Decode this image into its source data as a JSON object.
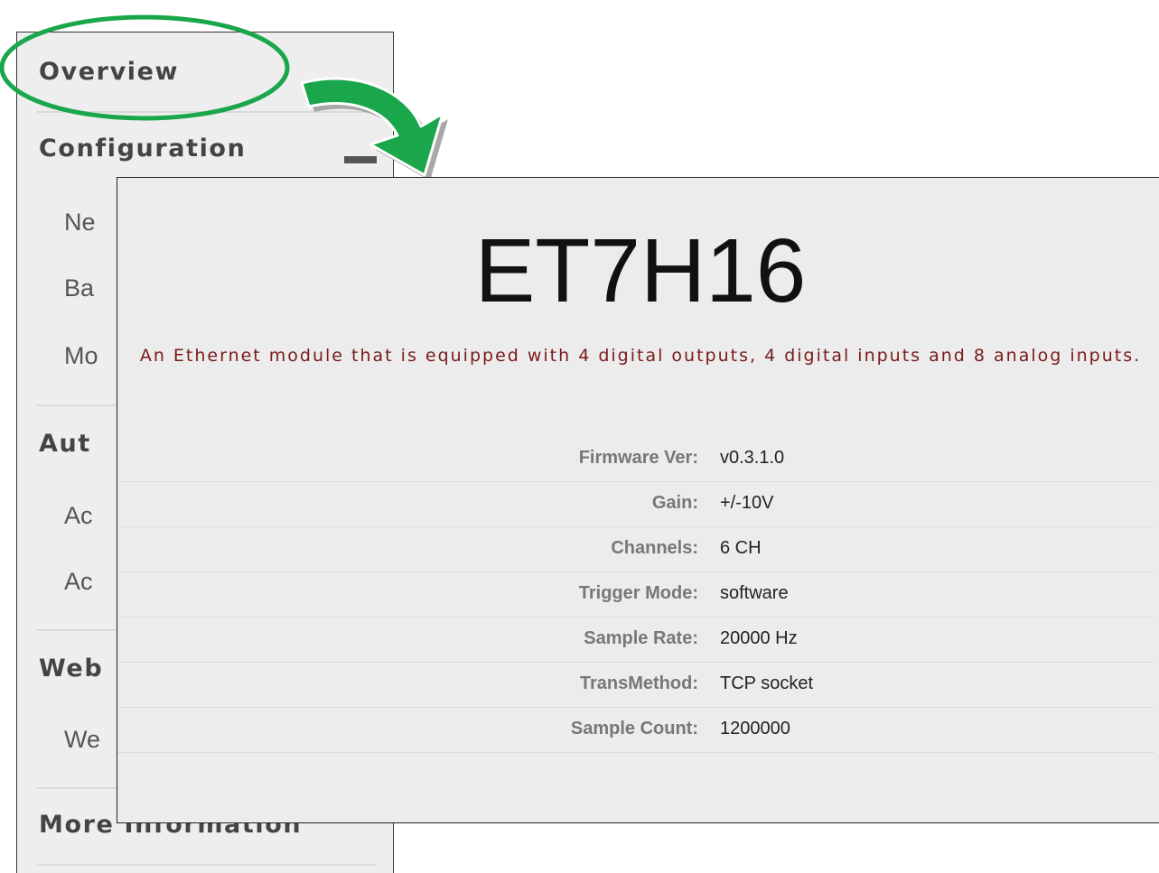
{
  "sidebar": {
    "overview_label": "Overview",
    "configuration_label": "Configuration",
    "config_items": [
      "Ne",
      "Ba",
      "Mo"
    ],
    "authentication_label": "Aut",
    "auth_items": [
      "Ac",
      "Ac"
    ],
    "web_label": "Web",
    "web_items": [
      "We"
    ],
    "more_info_label": "More Information"
  },
  "overview": {
    "device_name": "ET7H16",
    "description": "An Ethernet module that is equipped with 4 digital outputs, 4 digital inputs and 8 analog inputs.",
    "specs": [
      {
        "label": "Firmware Ver:",
        "value": "v0.3.1.0"
      },
      {
        "label": "Gain:",
        "value": "+/-10V"
      },
      {
        "label": "Channels:",
        "value": "6 CH"
      },
      {
        "label": "Trigger Mode:",
        "value": "software"
      },
      {
        "label": "Sample Rate:",
        "value": "20000 Hz"
      },
      {
        "label": "TransMethod:",
        "value": "TCP socket"
      },
      {
        "label": "Sample Count:",
        "value": "1200000"
      }
    ]
  },
  "colors": {
    "highlight_green": "#1aa64a",
    "arrow_gray": "#9a9a9a",
    "description_text": "#7a1a1a"
  },
  "icons": {
    "highlight": "ellipse-highlight",
    "arrow": "curved-arrow-icon"
  }
}
